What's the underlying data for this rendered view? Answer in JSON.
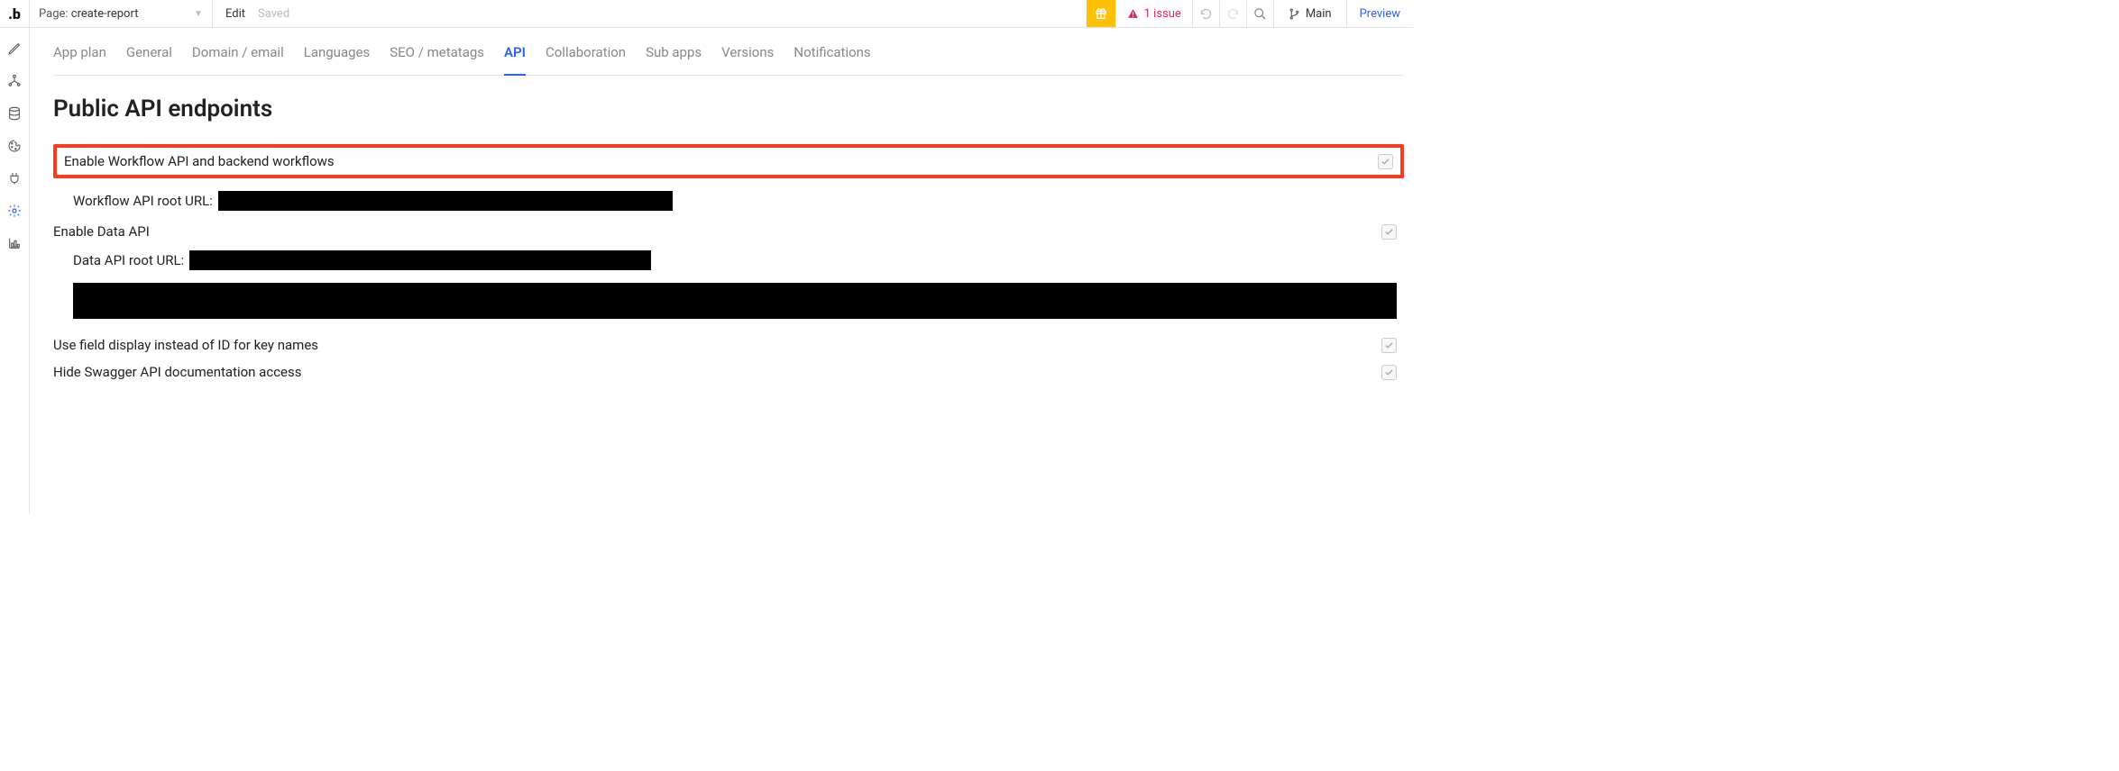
{
  "header": {
    "page_prefix": "Page:",
    "page_name": "create-report",
    "edit_label": "Edit",
    "saved_label": "Saved",
    "issue_count": "1 issue",
    "branch_name": "Main",
    "preview": "Preview"
  },
  "tabs": [
    "App plan",
    "General",
    "Domain / email",
    "Languages",
    "SEO / metatags",
    "API",
    "Collaboration",
    "Sub apps",
    "Versions",
    "Notifications"
  ],
  "active_tab_index": 5,
  "page_title": "Public API endpoints",
  "rows": {
    "enable_workflow": "Enable Workflow API and backend workflows",
    "workflow_url_label": "Workflow API root URL:",
    "enable_data": "Enable Data API",
    "data_url_label": "Data API root URL:",
    "field_display": "Use field display instead of ID for key names",
    "hide_swagger": "Hide Swagger API documentation access"
  }
}
